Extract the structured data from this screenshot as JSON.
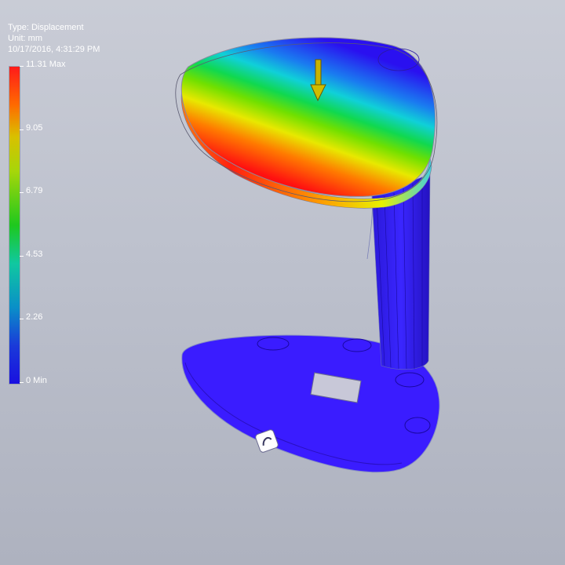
{
  "header": {
    "type_line": "Type: Displacement",
    "unit_line": "Unit: mm",
    "timestamp": "10/17/2016, 4:31:29 PM"
  },
  "legend": {
    "max_label": "11.31 Max",
    "tick_9": "9.05",
    "tick_7": "6.79",
    "tick_4": "4.53",
    "tick_2": "2.26",
    "min_label": "0 Min"
  },
  "colors": {
    "max": "#ff1a1a",
    "mid": "#1ec81e",
    "min": "#1a10e0",
    "load_arrow": "#c8b400"
  },
  "icons": {
    "load_arrow": "down-arrow-icon",
    "base_badge": "logo-badge-icon"
  }
}
